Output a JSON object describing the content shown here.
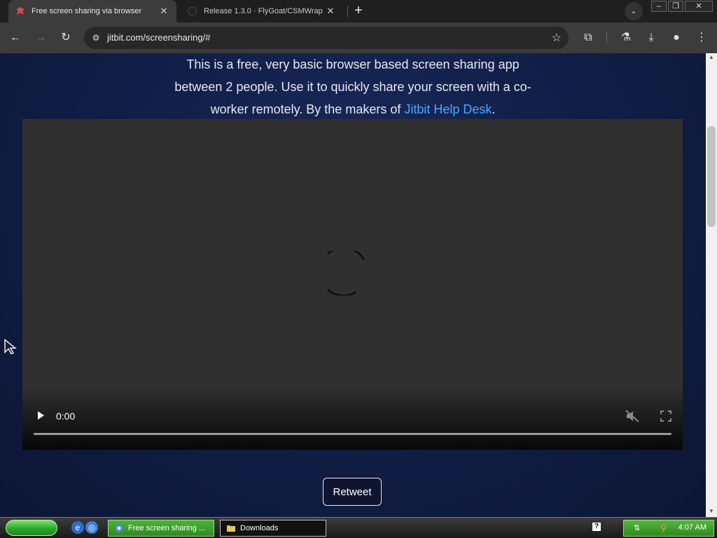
{
  "browser": {
    "tabs": [
      {
        "title": "Free screen sharing via browser",
        "active": true,
        "favicon": "jitbit-icon",
        "accent": "#e0484f"
      },
      {
        "title": "Release 1.3.0 · FlyGoat/CSMWrap",
        "active": false,
        "favicon": "github-icon"
      }
    ],
    "url": "jitbit.com/screensharing/#"
  },
  "page": {
    "intro_line1": "This is a free, very basic browser based screen sharing app",
    "intro_line2": "between 2 people. Use it to quickly share your screen with a co-",
    "intro_line3": "worker remotely. By the makers of ",
    "intro_link": "Jitbit Help Desk",
    "intro_end": ".",
    "link_color": "#4aa8ff",
    "video": {
      "time": "0:00",
      "progress": 0,
      "muted": true,
      "loading": true
    },
    "retweet_label": "Retweet"
  },
  "taskbar": {
    "items": [
      {
        "label": "Free screen sharing ...",
        "icon": "chrome-icon",
        "active": true
      },
      {
        "label": "Downloads",
        "icon": "folder-icon",
        "active": false
      }
    ],
    "clock": "4:07 AM"
  }
}
